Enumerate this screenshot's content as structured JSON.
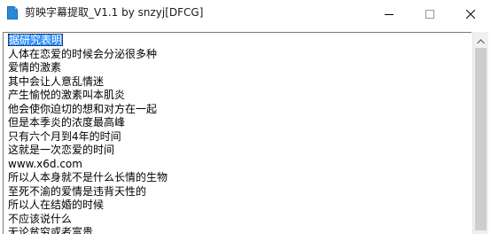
{
  "window": {
    "title": "剪映字幕提取_V1.1 by snzyj[DFCG]"
  },
  "controls": {
    "minimize_icon": "minimize-icon",
    "maximize_icon": "maximize-icon",
    "close_icon": "close-icon"
  },
  "content": {
    "selected_text": "据研究表明",
    "lines": [
      "人体在恋爱的时候会分泌很多种",
      "爱情的激素",
      "其中会让人意乱情迷",
      "产生愉悦的激素叫本肌炎",
      "他会使你迫切的想和对方在一起",
      "但是本季炎的浓度最高峰",
      "只有六个月到4年的时间",
      "这就是一次恋爱的时间",
      "www.x6d.com",
      "所以人本身就不是什么长情的生物",
      "至死不渝的爱情是违背天性的",
      "所以人在结婚的时候",
      "不应该说什么",
      "无论贫穷或者富贵"
    ]
  },
  "colors": {
    "selection": "#3390ff",
    "scrollbar_thumb": "#cdcdcd",
    "scrollbar_track": "#f0f0f0"
  }
}
